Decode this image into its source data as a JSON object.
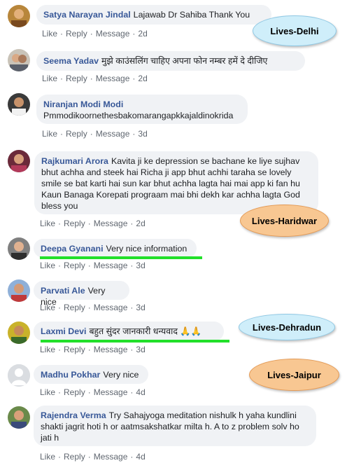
{
  "actions": {
    "like": "Like",
    "reply": "Reply",
    "message": "Message",
    "sep": "·"
  },
  "comments": [
    {
      "author": "Satya Narayan Jindal",
      "text": "Lajawab Dr Sahiba Thank You",
      "time": "2d"
    },
    {
      "author": "Seema Yadav",
      "text": "मुझे काउंसलिंग चाहिए अपना फोन नम्बर हमें दे दीजिए",
      "time": "2d"
    },
    {
      "author": "Niranjan Modi Modi",
      "text": "Pmmodikoornethesbakomarangapkkajaldinokrida",
      "time": "3d"
    },
    {
      "author": "Rajkumari Arora",
      "text": "Kavita ji ke depression se bachane ke liye sujhav bhut achha and steek hai Richa ji app bhut achhi taraha se lovely smile se bat karti hai sun kar bhut achha lagta hai mai app ki fan hu Kaun Banaga Korepati prograam mai bhi dekh kar achha lagta God bless you",
      "time": "2d"
    },
    {
      "author": "Deepa Gyanani",
      "text": "Very nice information",
      "time": "3d"
    },
    {
      "author": "Parvati Ale",
      "text": "Very nice",
      "time": "3d"
    },
    {
      "author": "Laxmi Devi",
      "text": "बहुत सुंदर जानकारी धन्यवाद 🙏🙏",
      "time": "3d"
    },
    {
      "author": "Madhu Pokhar",
      "text": "Very nice",
      "time": "4d"
    },
    {
      "author": "Rajendra Verma",
      "text": "Try Sahajyoga meditation nishulk h yaha kundlini shakti jagrit hoti h or aatmsakshatkar milta h. A to z problem solv ho jati h",
      "time": "4d"
    }
  ],
  "annotations": {
    "delhi": "Lives-Delhi",
    "haridwar": "Lives-Haridwar",
    "dehradun": "Lives-Dehradun",
    "jaipur": "Lives-Jaipur"
  },
  "colors": {
    "author": "#385898",
    "bubble": "#f0f2f5",
    "action": "#606770",
    "highlight": "#22e02a",
    "badge_blue": "#cfeefa",
    "badge_orange": "#f8c792"
  },
  "icons": [
    "user-avatar-photo",
    "default-avatar-silhouette"
  ]
}
